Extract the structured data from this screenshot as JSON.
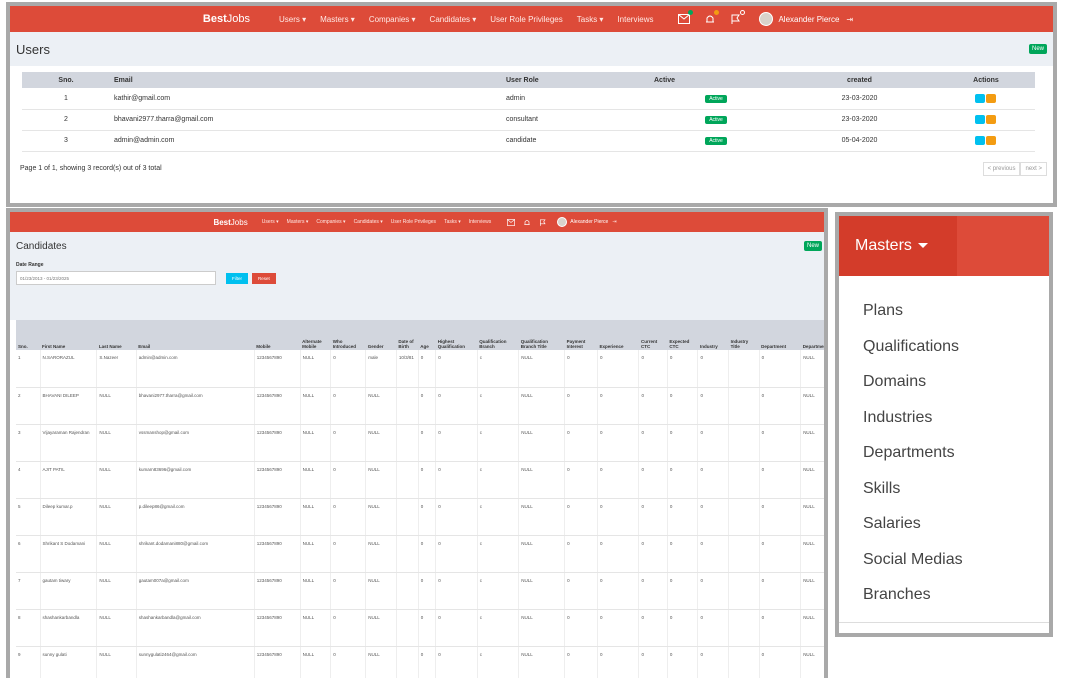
{
  "nav": {
    "brand_bold": "Best",
    "brand_rest": "Jobs",
    "menu": [
      "Users",
      "Masters",
      "Companies",
      "Candidates",
      "User Role Privileges",
      "Tasks",
      "Interviews"
    ],
    "user_name": "Alexander Pierce"
  },
  "users": {
    "title": "Users",
    "new_label": "New",
    "columns": [
      "Sno.",
      "Email",
      "User Role",
      "Active",
      "created",
      "Actions"
    ],
    "rows": [
      {
        "sno": "1",
        "email": "kathir@gmail.com",
        "role": "admin",
        "active": "Active",
        "created": "23-03-2020"
      },
      {
        "sno": "2",
        "email": "bhavani2977.tharra@gmail.com",
        "role": "consultant",
        "active": "Active",
        "created": "23-03-2020"
      },
      {
        "sno": "3",
        "email": "admin@admin.com",
        "role": "candidate",
        "active": "Active",
        "created": "05-04-2020"
      }
    ],
    "summary": "Page 1 of 1, showing 3 record(s) out of 3 total",
    "prev": "< previous",
    "next": "next >"
  },
  "candidates": {
    "title": "Candidates",
    "new_label": "New",
    "date_range_label": "Date Range",
    "date_range_value": "01/23/2013 - 01/23/2025",
    "filter_label": "Filter",
    "reset_label": "Reset",
    "columns": [
      "Sno.",
      "First Name",
      "Last Name",
      "Email",
      "Mobile",
      "Alternate Mobile",
      "Who Introduced",
      "Gender",
      "Date of Birth",
      "Age",
      "Highest Qualification",
      "Qualification Branch",
      "Qualification Branch Title",
      "Payment Interest",
      "Experience",
      "Current CTC",
      "Expected CTC",
      "Industry",
      "Industry Title",
      "Department",
      "Department Title",
      ""
    ],
    "rows": [
      [
        "1",
        "N.SARORAZUL",
        "S.Nazeer",
        "admin@admin.com",
        "1234567890",
        "NULL",
        "0",
        "male",
        "10/3/81",
        "0",
        "0",
        "c",
        "NULL",
        "0",
        "0",
        "0",
        "0",
        "0",
        "",
        "0",
        "NULL",
        ""
      ],
      [
        "2",
        "BHAVANI DILEEP",
        "NULL",
        "bhavani2977.tharra@gmail.com",
        "1234567890",
        "NULL",
        "0",
        "NULL",
        "",
        "0",
        "0",
        "c",
        "NULL",
        "0",
        "0",
        "0",
        "0",
        "0",
        "",
        "0",
        "NULL",
        ""
      ],
      [
        "3",
        "Vijayaraman Rajendran",
        "NULL",
        "vssmanshop@gmail.com",
        "1234567890",
        "NULL",
        "0",
        "NULL",
        "",
        "0",
        "0",
        "c",
        "NULL",
        "0",
        "0",
        "0",
        "0",
        "0",
        "",
        "0",
        "NULL",
        ""
      ],
      [
        "4",
        "AJIT PATIL",
        "NULL",
        "kumarn83696@gmail.com",
        "1234567890",
        "NULL",
        "0",
        "NULL",
        "",
        "0",
        "0",
        "c",
        "NULL",
        "0",
        "0",
        "0",
        "0",
        "0",
        "",
        "0",
        "NULL",
        ""
      ],
      [
        "5",
        "Dileep kumar.p",
        "NULL",
        "p.dileep86@gmail.com",
        "1234567890",
        "NULL",
        "0",
        "NULL",
        "",
        "0",
        "0",
        "c",
        "NULL",
        "0",
        "0",
        "0",
        "0",
        "0",
        "",
        "0",
        "NULL",
        ""
      ],
      [
        "6",
        "Shrikant S Dodamani",
        "NULL",
        "shrikant.dodamani880@gmail.com",
        "1234567890",
        "NULL",
        "0",
        "NULL",
        "",
        "0",
        "0",
        "c",
        "NULL",
        "0",
        "0",
        "0",
        "0",
        "0",
        "",
        "0",
        "NULL",
        ""
      ],
      [
        "7",
        "gautam tiwary",
        "NULL",
        "gautam007a@gmail.com",
        "1234567890",
        "NULL",
        "0",
        "NULL",
        "",
        "0",
        "0",
        "c",
        "NULL",
        "0",
        "0",
        "0",
        "0",
        "0",
        "",
        "0",
        "NULL",
        ""
      ],
      [
        "8",
        "shashankarbandla",
        "NULL",
        "shashankarbandla@gmail.com",
        "1234567890",
        "NULL",
        "0",
        "NULL",
        "",
        "0",
        "0",
        "c",
        "NULL",
        "0",
        "0",
        "0",
        "0",
        "0",
        "",
        "0",
        "NULL",
        ""
      ],
      [
        "9",
        "sunny gulati",
        "NULL",
        "sunnygulati2464@gmail.com",
        "1234567890",
        "NULL",
        "0",
        "NULL",
        "",
        "0",
        "0",
        "c",
        "NULL",
        "0",
        "0",
        "0",
        "0",
        "0",
        "",
        "0",
        "NULL",
        ""
      ]
    ]
  },
  "masters_menu": {
    "title": "Masters",
    "items": [
      "Plans",
      "Qualifications",
      "Domains",
      "Industries",
      "Departments",
      "Skills",
      "Salaries",
      "Social Medias",
      "Branches"
    ]
  },
  "colors": {
    "header_red": "#dd4b39",
    "active_green": "#00a65a",
    "view_blue": "#00c0ef",
    "edit_orange": "#f39c12",
    "reset_red": "#dd4b39"
  },
  "icons": [
    "envelope-icon",
    "bell-icon",
    "flag-icon",
    "avatar",
    "sign-out-icon",
    "eye-icon",
    "edit-icon",
    "caret-down-icon"
  ]
}
